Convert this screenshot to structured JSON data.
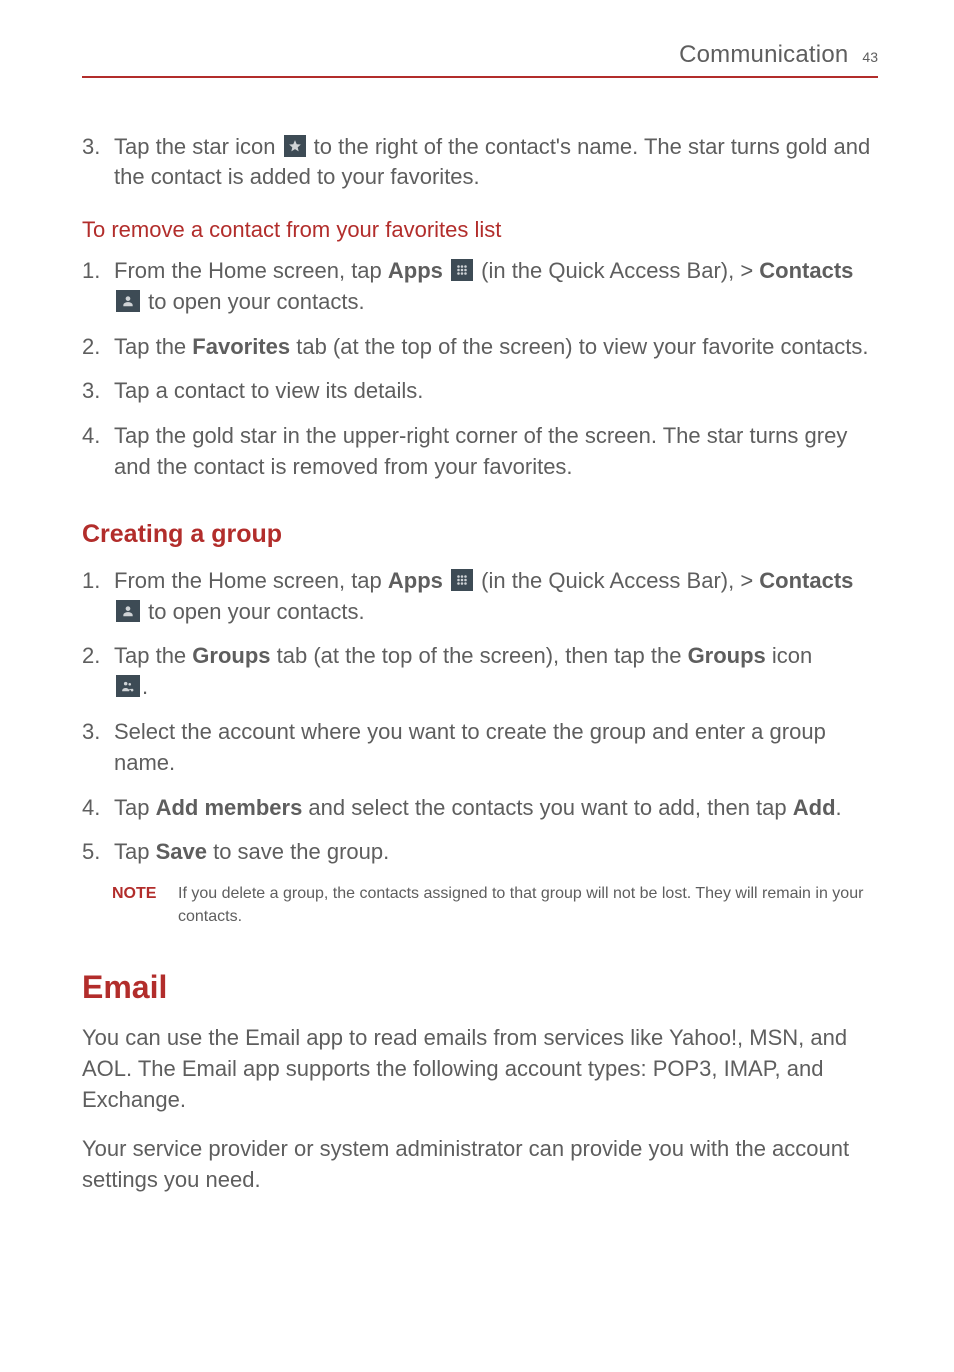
{
  "header": {
    "title": "Communication",
    "page": "43"
  },
  "top_step": {
    "num": "3.",
    "before": "Tap the star icon ",
    "after": " to the right of the contact's name. The star turns gold and the contact is added to your favorites."
  },
  "remove": {
    "heading": "To remove a contact from your favorites list",
    "steps": {
      "1": {
        "num": "1.",
        "pre": "From the Home screen, tap ",
        "apps": "Apps",
        "mid": " (in the Quick Access Bar), > ",
        "contacts": "Contacts",
        "post": " to open your contacts."
      },
      "2": {
        "num": "2.",
        "pre": "Tap the ",
        "fav": "Favorites",
        "post": " tab (at the top of the screen) to view your favorite contacts."
      },
      "3": {
        "num": "3.",
        "text": "Tap a contact to view its details."
      },
      "4": {
        "num": "4.",
        "text": "Tap the gold star in the upper-right corner of the screen. The star turns grey and the contact is removed from your favorites."
      }
    }
  },
  "group": {
    "heading": "Creating a group",
    "steps": {
      "1": {
        "num": "1.",
        "pre": "From the Home screen, tap ",
        "apps": "Apps",
        "mid": " (in the Quick Access Bar), > ",
        "contacts": "Contacts",
        "post": " to open your contacts."
      },
      "2": {
        "num": "2.",
        "pre": "Tap the ",
        "groups1": "Groups",
        "mid": " tab (at the top of the screen), then tap the ",
        "groups2": "Groups",
        "post_icon_word": " icon ",
        "period": "."
      },
      "3": {
        "num": "3.",
        "text": "Select the account where you want to create the group and enter a group name."
      },
      "4": {
        "num": "4.",
        "pre": "Tap ",
        "addmembers": "Add members",
        "mid": " and select the contacts you want to add, then tap ",
        "add": "Add",
        "period": "."
      },
      "5": {
        "num": "5.",
        "pre": "Tap ",
        "save": "Save",
        "post": " to save the group."
      }
    },
    "note": {
      "label": "NOTE",
      "text": "If you delete a group, the contacts assigned to that group will not be lost. They will remain in your contacts."
    }
  },
  "email": {
    "heading": "Email",
    "p1": "You can use the Email app to read emails from services like Yahoo!, MSN, and AOL. The Email app supports the following account types: POP3, IMAP, and Exchange.",
    "p2": "Your service provider or system administrator can provide you with the account settings you need."
  }
}
